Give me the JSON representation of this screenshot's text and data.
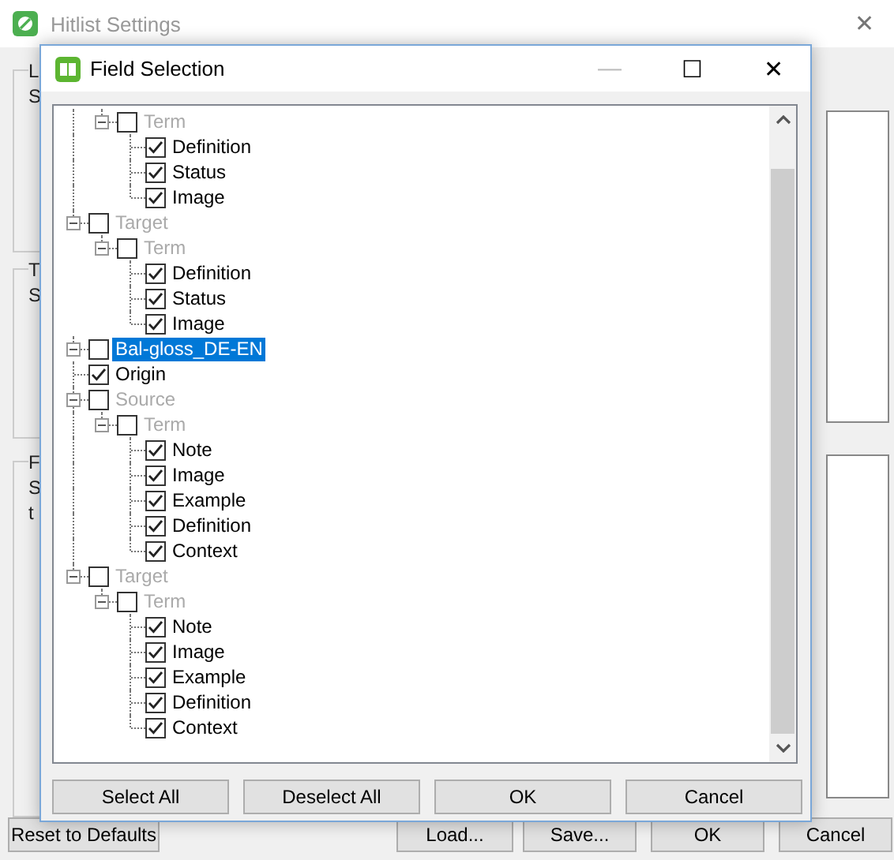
{
  "window": {
    "title": "Hitlist Settings",
    "close": "✕"
  },
  "background_groups": [
    {
      "title": "L",
      "lines": [
        "S"
      ]
    },
    {
      "title": "T",
      "lines": [
        "S"
      ]
    },
    {
      "title": "F",
      "lines": [
        "S",
        "t"
      ]
    }
  ],
  "dialog": {
    "title": "Field Selection",
    "minimize": "—",
    "maximize": "☐",
    "close": "✕"
  },
  "tree": {
    "items": [
      {
        "children": [
          {
            "children": [
              {
                "label": "Term",
                "checked": false,
                "greyed": true,
                "expanded": true,
                "selected": false,
                "children": [
                  {
                    "label": "Definition",
                    "checked": true,
                    "greyed": false,
                    "selected": false
                  },
                  {
                    "label": "Status",
                    "checked": true,
                    "greyed": false,
                    "selected": false
                  },
                  {
                    "label": "Image",
                    "checked": true,
                    "greyed": false,
                    "selected": false
                  }
                ]
              }
            ]
          },
          {
            "label": "Target",
            "checked": false,
            "greyed": true,
            "expanded": true,
            "selected": false,
            "children": [
              {
                "label": "Term",
                "checked": false,
                "greyed": true,
                "expanded": true,
                "selected": false,
                "children": [
                  {
                    "label": "Definition",
                    "checked": true,
                    "greyed": false,
                    "selected": false
                  },
                  {
                    "label": "Status",
                    "checked": true,
                    "greyed": false,
                    "selected": false
                  },
                  {
                    "label": "Image",
                    "checked": true,
                    "greyed": false,
                    "selected": false
                  }
                ]
              }
            ]
          }
        ]
      },
      {
        "label": "Bal-gloss_DE-EN",
        "checked": false,
        "greyed": false,
        "expanded": true,
        "selected": true,
        "children": [
          {
            "label": "Origin",
            "checked": true,
            "greyed": false,
            "selected": false
          },
          {
            "label": "Source",
            "checked": false,
            "greyed": true,
            "expanded": true,
            "selected": false,
            "children": [
              {
                "label": "Term",
                "checked": false,
                "greyed": true,
                "expanded": true,
                "selected": false,
                "children": [
                  {
                    "label": "Note",
                    "checked": true,
                    "greyed": false,
                    "selected": false
                  },
                  {
                    "label": "Image",
                    "checked": true,
                    "greyed": false,
                    "selected": false
                  },
                  {
                    "label": "Example",
                    "checked": true,
                    "greyed": false,
                    "selected": false
                  },
                  {
                    "label": "Definition",
                    "checked": true,
                    "greyed": false,
                    "selected": false
                  },
                  {
                    "label": "Context",
                    "checked": true,
                    "greyed": false,
                    "selected": false
                  }
                ]
              }
            ]
          },
          {
            "label": "Target",
            "checked": false,
            "greyed": true,
            "expanded": true,
            "selected": false,
            "children": [
              {
                "label": "Term",
                "checked": false,
                "greyed": true,
                "expanded": true,
                "selected": false,
                "children": [
                  {
                    "label": "Note",
                    "checked": true,
                    "greyed": false,
                    "selected": false
                  },
                  {
                    "label": "Image",
                    "checked": true,
                    "greyed": false,
                    "selected": false
                  },
                  {
                    "label": "Example",
                    "checked": true,
                    "greyed": false,
                    "selected": false
                  },
                  {
                    "label": "Definition",
                    "checked": true,
                    "greyed": false,
                    "selected": false
                  },
                  {
                    "label": "Context",
                    "checked": true,
                    "greyed": false,
                    "selected": false
                  }
                ]
              }
            ]
          }
        ]
      }
    ]
  },
  "dialog_buttons": [
    "Select All",
    "Deselect All",
    "OK",
    "Cancel"
  ],
  "window_buttons": [
    "Reset to Defaults",
    "Load...",
    "Save...",
    "OK",
    "Cancel"
  ]
}
